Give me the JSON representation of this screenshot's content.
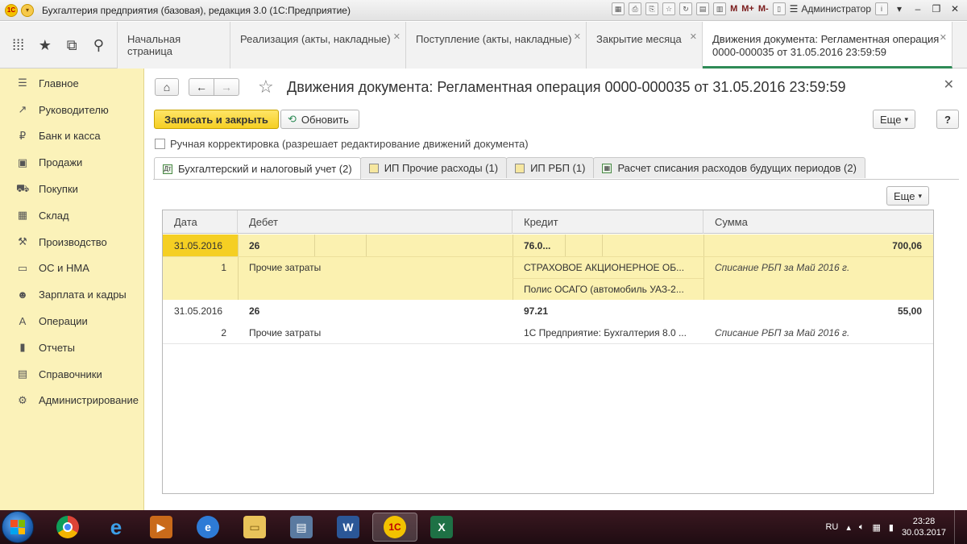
{
  "window": {
    "title": "Бухгалтерия предприятия (базовая), редакция 3.0  (1С:Предприятие)",
    "user": "Администратор",
    "m_labels": [
      "M",
      "M+",
      "M-"
    ]
  },
  "top_tabs": [
    {
      "label": "Начальная страница",
      "closable": false
    },
    {
      "label": "Реализация (акты, накладные)",
      "closable": true
    },
    {
      "label": "Поступление (акты, накладные)",
      "closable": true
    },
    {
      "label": "Закрытие месяца",
      "closable": true
    },
    {
      "label_line1": "Движения документа: Регламентная операция",
      "label_line2": "0000-000035 от 31.05.2016 23:59:59",
      "closable": true,
      "active": true
    }
  ],
  "sidebar": {
    "items": [
      {
        "label": "Главное",
        "icon": "menu-icon"
      },
      {
        "label": "Руководителю",
        "icon": "trend-icon"
      },
      {
        "label": "Банк и касса",
        "icon": "ruble-icon"
      },
      {
        "label": "Продажи",
        "icon": "sales-icon"
      },
      {
        "label": "Покупки",
        "icon": "cart-icon"
      },
      {
        "label": "Склад",
        "icon": "warehouse-icon"
      },
      {
        "label": "Производство",
        "icon": "factory-icon"
      },
      {
        "label": "ОС и НМА",
        "icon": "assets-icon"
      },
      {
        "label": "Зарплата и кадры",
        "icon": "people-icon"
      },
      {
        "label": "Операции",
        "icon": "operations-icon"
      },
      {
        "label": "Отчеты",
        "icon": "reports-icon"
      },
      {
        "label": "Справочники",
        "icon": "book-icon"
      },
      {
        "label": "Администрирование",
        "icon": "gear-icon"
      }
    ]
  },
  "document": {
    "title": "Движения документа: Регламентная операция 0000-000035 от 31.05.2016 23:59:59",
    "save_close_label": "Записать и закрыть",
    "refresh_label": "Обновить",
    "more_label": "Еще",
    "help_label": "?",
    "manual_adjust_label": "Ручная корректировка (разрешает редактирование движений документа)"
  },
  "inner_tabs": [
    {
      "label": "Бухгалтерский и налоговый учет (2)",
      "active": true
    },
    {
      "label": "ИП Прочие расходы (1)"
    },
    {
      "label": "ИП РБП (1)"
    },
    {
      "label": "Расчет списания расходов будущих периодов (2)"
    }
  ],
  "table": {
    "more_label": "Еще",
    "columns": [
      "Дата",
      "Дебет",
      "Кредит",
      "Сумма"
    ],
    "rows": [
      {
        "date": "31.05.2016",
        "number": "1",
        "debit_account": "26",
        "debit_sub": "Прочие затраты",
        "credit_account": "76.0...",
        "credit_sub1": "СТРАХОВОЕ АКЦИОНЕРНОЕ ОБ...",
        "credit_sub2": "Полис ОСАГО (автомобиль УАЗ-2...",
        "amount": "700,06",
        "comment": "Списание РБП за Май 2016 г.",
        "selected": true
      },
      {
        "date": "31.05.2016",
        "number": "2",
        "debit_account": "26",
        "debit_sub": "Прочие затраты",
        "credit_account": "97.21",
        "credit_sub1": "1С Предприятие: Бухгалтерия 8.0 ...",
        "amount": "55,00",
        "comment": "Списание РБП за Май 2016 г.",
        "selected": false
      }
    ]
  },
  "taskbar": {
    "lang": "RU",
    "time": "23:28",
    "date": "30.03.2017"
  }
}
